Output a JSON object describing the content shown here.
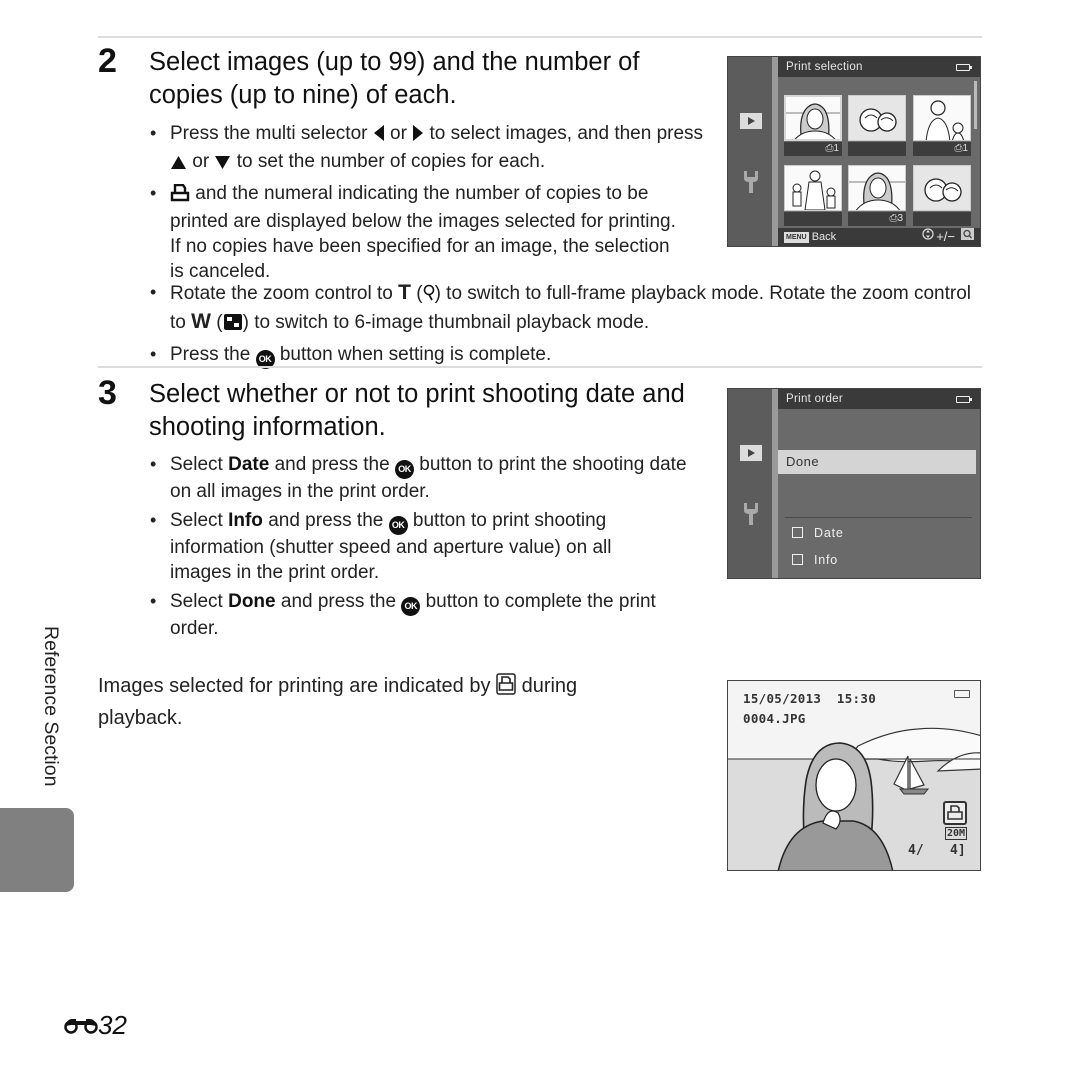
{
  "step2": {
    "number": "2",
    "title": "Select images (up to 99) and the number of copies (up to nine) of each.",
    "bullets": {
      "b1": {
        "a": "Press the multi selector",
        "or1": "or",
        "b": "to select images, and then press",
        "or2": "or",
        "c": "to set the number of copies for each."
      },
      "b2": {
        "a": "and the numeral indicating the number of copies to be printed are displayed below the images selected for printing. If no copies have been specified for an image, the selection is canceled."
      },
      "b3": {
        "a": "Rotate the zoom control to",
        "t": "T",
        "b": "to switch to full-frame playback mode. Rotate the zoom control to",
        "w": "W",
        "c": "to switch to 6-image thumbnail playback mode."
      },
      "b4": {
        "a": "Press the",
        "b": "button when setting is complete."
      }
    }
  },
  "step3": {
    "number": "3",
    "title": "Select whether or not to print shooting date and shooting information.",
    "bullets": {
      "b1": {
        "a": "Select",
        "bold": "Date",
        "b": "and press the",
        "c": "button to print the shooting date on all images in the print order."
      },
      "b2": {
        "a": "Select",
        "bold": "Info",
        "b": "and press the",
        "c": "button to print shooting information (shutter speed and aperture value) on all images in the print order."
      },
      "b3": {
        "a": "Select",
        "bold": "Done",
        "b": "and press the",
        "c": "button to complete the print order."
      }
    }
  },
  "icons": {
    "ok": "OK"
  },
  "screen_print_selection": {
    "title": "Print selection",
    "thumbnails": [
      {
        "subject": "woman-portrait",
        "copies": "1",
        "selected": true
      },
      {
        "subject": "roses",
        "copies": ""
      },
      {
        "subject": "woman-with-child",
        "copies": "1"
      },
      {
        "subject": "family-walk",
        "copies": ""
      },
      {
        "subject": "woman-portrait",
        "copies": "3"
      },
      {
        "subject": "roses",
        "copies": ""
      }
    ],
    "print_glyph": "⎙",
    "back_badge": "MENU",
    "back_label": "Back",
    "controls_hint": "+/−"
  },
  "screen_print_order": {
    "title": "Print order",
    "items": [
      "Done"
    ],
    "checkboxes": [
      {
        "label": "Date",
        "checked": false
      },
      {
        "label": "Info",
        "checked": false
      }
    ]
  },
  "paragraph": {
    "a": "Images selected for printing are indicated by",
    "b": "during playback."
  },
  "screen_playback": {
    "datetime": "15/05/2013  15:30",
    "filename": "0004.JPG",
    "image_size": "20M",
    "counter_current": "4/",
    "counter_total": "4]"
  },
  "side_tab": {
    "label": "Reference Section"
  },
  "page": {
    "number": "32"
  }
}
